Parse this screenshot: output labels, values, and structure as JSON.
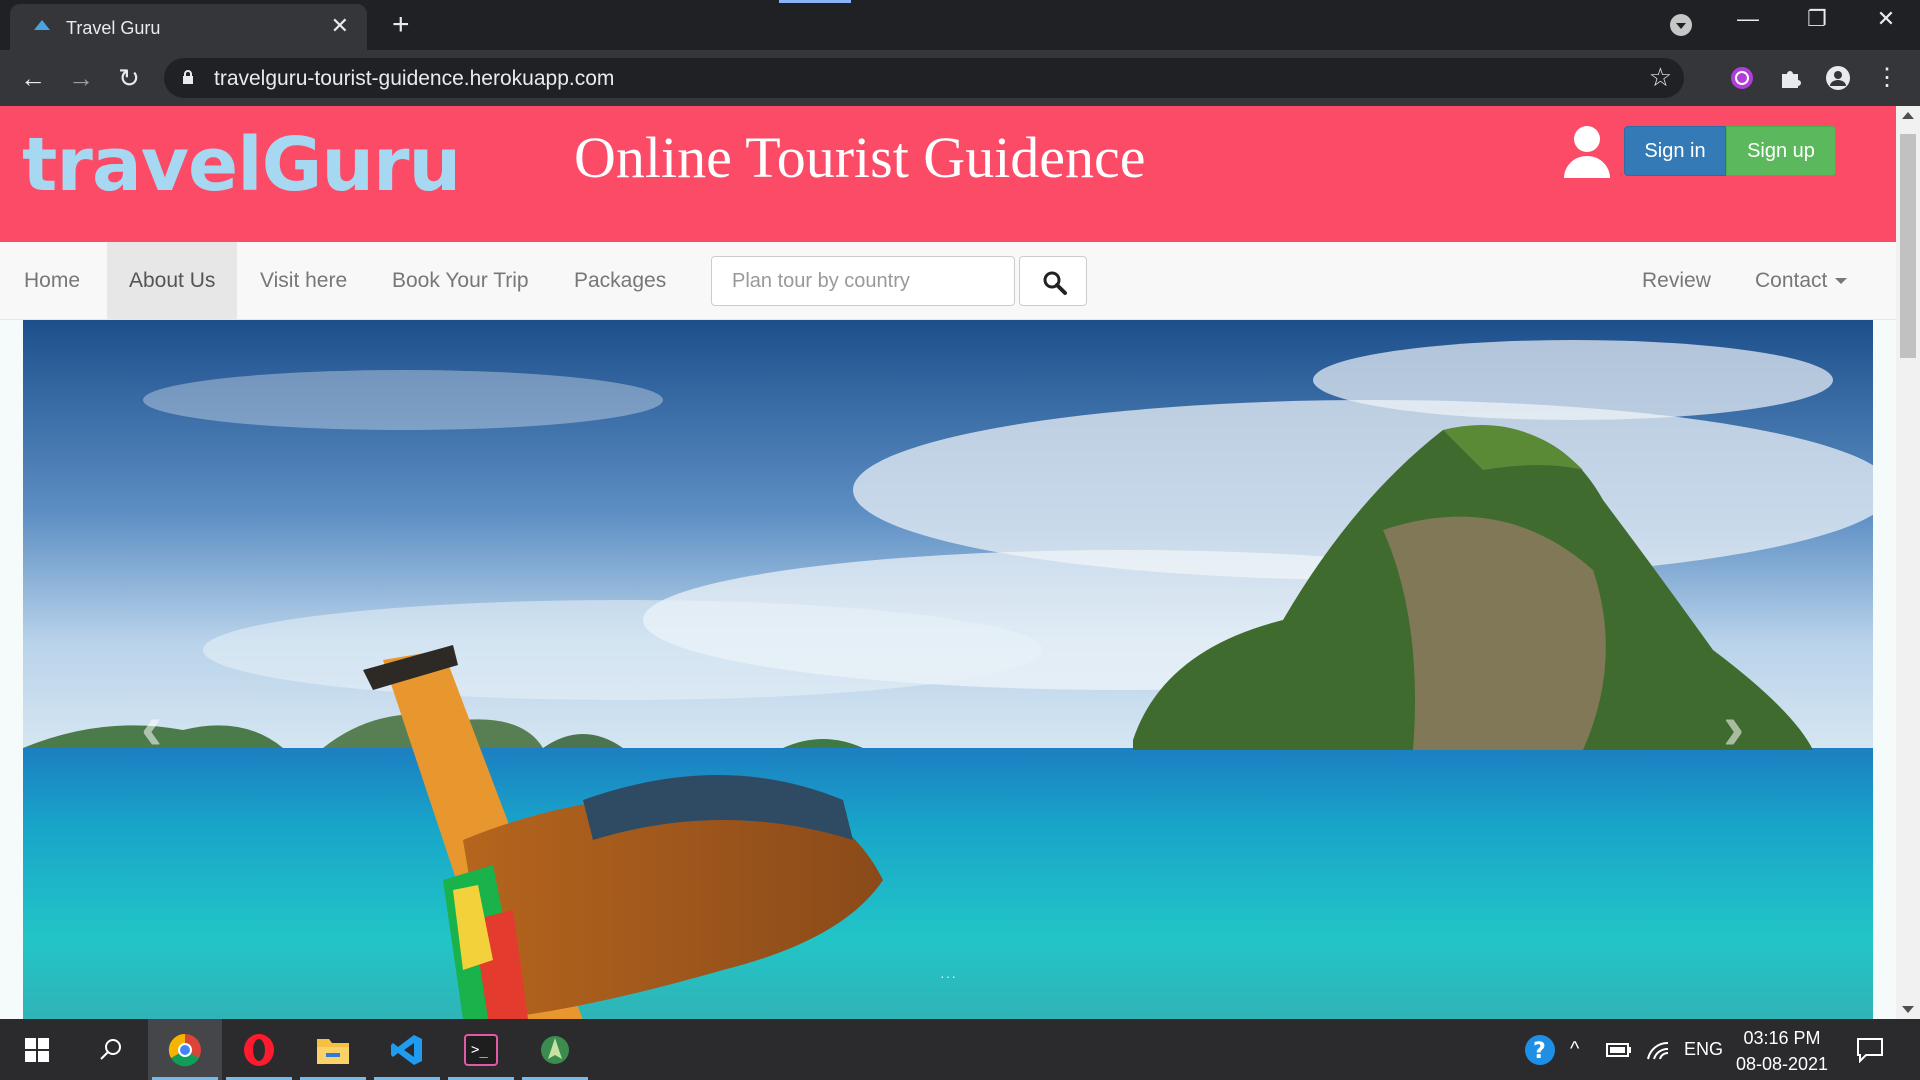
{
  "browser": {
    "tab_title": "Travel Guru",
    "tab_close": "✕",
    "new_tab": "+",
    "url": "travelguru-tourist-guidence.herokuapp.com",
    "window_minimize": "—",
    "window_restore": "❐",
    "window_close": "✕"
  },
  "site": {
    "logo": "travelGuru",
    "title": "Online Tourist Guidence",
    "signin_label": "Sign in",
    "signup_label": "Sign up",
    "colors": {
      "header": "#fc4b67",
      "logo": "#a6d8f2",
      "signin": "#337ab7",
      "signup": "#5cb85c"
    }
  },
  "nav": {
    "items": [
      "Home",
      "About Us",
      "Visit here",
      "Book Your Trip",
      "Packages"
    ],
    "active": "About Us",
    "search_placeholder": "Plan tour by country",
    "right_items": [
      "Review",
      "Contact"
    ]
  },
  "carousel": {
    "prev": "‹",
    "next": "›",
    "indicators": "···"
  },
  "taskbar": {
    "apps": [
      "windows-start",
      "search",
      "chrome",
      "opera",
      "file-explorer",
      "vscode",
      "terminal",
      "android-studio"
    ],
    "active_app": "chrome",
    "lang": "ENG",
    "time": "03:16 PM",
    "date": "08-08-2021"
  }
}
